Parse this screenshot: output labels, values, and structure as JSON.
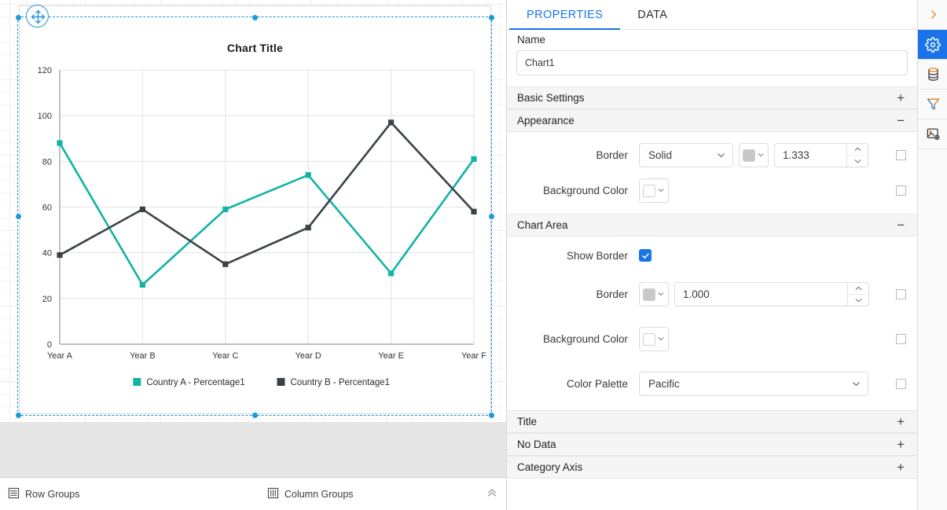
{
  "designer": {
    "chart": {
      "title": "Chart Title",
      "legend": [
        {
          "label": "Country A - Percentage1",
          "color": "#11b3a4"
        },
        {
          "label": "Country B - Percentage1",
          "color": "#3b4246"
        }
      ]
    },
    "groups_bar": {
      "row_groups_label": "Row Groups",
      "column_groups_label": "Column Groups",
      "row_groups_icon": "rows-icon",
      "column_groups_icon": "columns-icon",
      "collapse_icon": "chevron-up-double-icon"
    },
    "adorner": {
      "move_icon": "move-handle-icon"
    }
  },
  "chart_data": {
    "type": "line",
    "title": "Chart Title",
    "xlabel": "",
    "ylabel": "",
    "categories": [
      "Year A",
      "Year B",
      "Year C",
      "Year D",
      "Year E",
      "Year F"
    ],
    "ylim": [
      0,
      120
    ],
    "yticks": [
      0,
      20,
      40,
      60,
      80,
      100,
      120
    ],
    "grid": true,
    "legend_position": "bottom",
    "series": [
      {
        "name": "Country A - Percentage1",
        "color": "#11b3a4",
        "values": [
          88,
          26,
          59,
          74,
          31,
          81
        ]
      },
      {
        "name": "Country B - Percentage1",
        "color": "#3b4246",
        "values": [
          39,
          59,
          35,
          51,
          97,
          58
        ]
      }
    ]
  },
  "properties_panel": {
    "tabs": [
      {
        "label": "PROPERTIES",
        "active": true
      },
      {
        "label": "DATA",
        "active": false
      }
    ],
    "name": {
      "label": "Name",
      "value": "Chart1",
      "placeholder": "Name"
    },
    "sections": {
      "basic_settings": {
        "label": "Basic Settings",
        "sign": "+"
      },
      "appearance": {
        "label": "Appearance",
        "sign": "−",
        "border": {
          "label": "Border",
          "style": "Solid",
          "color": "#c8c8c8",
          "width": "1.333"
        },
        "background_color": {
          "label": "Background Color",
          "color": "#ffffff"
        }
      },
      "chart_area": {
        "label": "Chart Area",
        "sign": "−",
        "show_border": {
          "label": "Show Border",
          "checked": true
        },
        "border": {
          "label": "Border",
          "color": "#c8c8c8",
          "width": "1.000"
        },
        "background_color": {
          "label": "Background Color",
          "color": "#ffffff"
        },
        "color_palette": {
          "label": "Color Palette",
          "value": "Pacific"
        }
      },
      "title": {
        "label": "Title",
        "sign": "+"
      },
      "no_data": {
        "label": "No Data",
        "sign": "+"
      },
      "category_axis": {
        "label": "Category Axis",
        "sign": "+"
      }
    }
  },
  "icon_bar": [
    {
      "name": "expand-panel-icon",
      "glyph": "›",
      "active": false
    },
    {
      "name": "gear-icon",
      "glyph": "",
      "active": true
    },
    {
      "name": "database-icon",
      "glyph": "",
      "active": false
    },
    {
      "name": "filter-icon",
      "glyph": "",
      "active": false
    },
    {
      "name": "image-settings-icon",
      "glyph": "",
      "active": false
    }
  ],
  "colors": {
    "accent": "#1a73e8",
    "selection": "#2196d6",
    "series_a": "#11b3a4",
    "series_b": "#3b4246"
  }
}
